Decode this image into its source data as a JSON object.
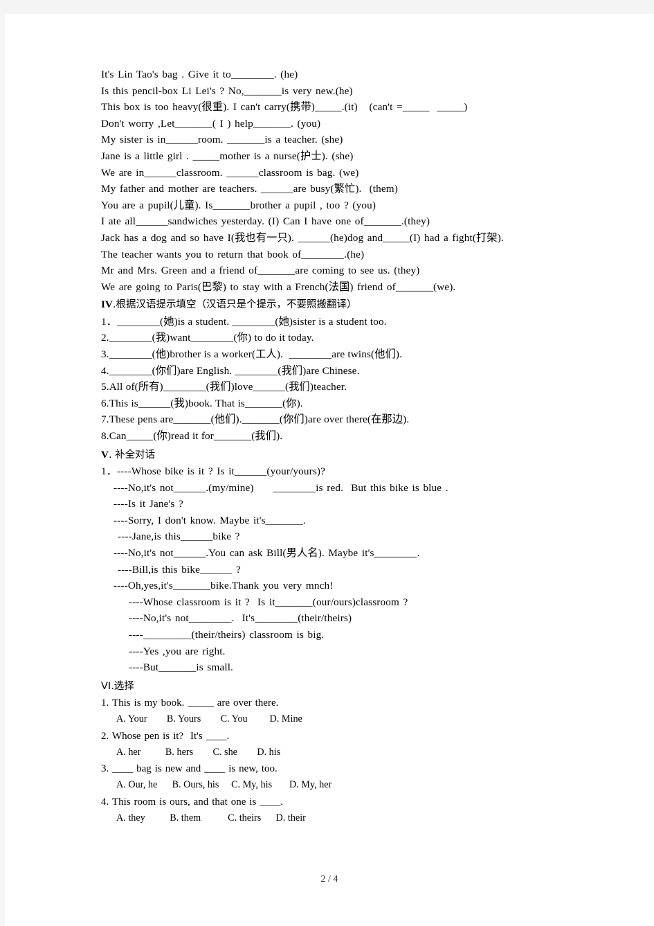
{
  "page": {
    "footer": "2 / 4"
  },
  "section_3_lines": [
    "It's Lin Tao's bag . Give it to________. (he)",
    "Is this pencil-box Li Lei's ? No,_______is very new.(he)",
    "This box is too heavy(很重). I can't carry(携带)_____.(it)   (can't =_____  _____)",
    "Don't worry ,Let_______( I ) help_______. (you)",
    "My sister is in______room. _______is a teacher. (she)",
    "Jane is a little girl . _____mother is a nurse(护士). (she)",
    "We are in______classroom. ______classroom is bag. (we)",
    "My father and mother are teachers. ______are busy(繁忙).  (them)",
    "You are a pupil(儿童). Is_______brother a pupil , too ? (you)",
    "I ate all______sandwiches yesterday. (I) Can I have one of_______.(they)",
    "Jack has a dog and so have I(我也有一只). ______(he)dog and_____(I) had a fight(打架).",
    "The teacher wants you to return that book of________.(he)",
    "Mr and Mrs. Green and a friend of_______are coming to see us. (they)",
    "We are going to Paris(巴黎) to stay with a French(法国) friend of_______(we)."
  ],
  "section_4": {
    "numeral": "IV",
    "heading": ".根据汉语提示填空（汉语只是个提示，不要照搬翻译）",
    "items": [
      "1．________(她)is a student. ________(她)sister is a student too.",
      "2.________(我)want________(你) to do it today.",
      "3.________(他)brother is a worker(工人).  ________are twins(他们).",
      "4.________(你们)are English. ________(我们)are Chinese.",
      "5.All of(所有)________(我们)love______(我们)teacher.",
      "6.This is______(我)book. That is_______(你).",
      "7.These pens are_______(他们)._______(你们)are over there(在那边).",
      "8.Can_____(你)read it for_______(我们)."
    ]
  },
  "section_5": {
    "numeral": "V",
    "heading": ". 补全对话",
    "lines": [
      {
        "text": "1．----Whose bike is it ? Is it______(your/yours)?",
        "indent": "a"
      },
      {
        "text": "----No,it's not______.(my/mine)     ________is red.  But this bike is blue .",
        "indent": "b"
      },
      {
        "text": "----Is it Jane's ?",
        "indent": "b"
      },
      {
        "text": "----Sorry, I don't know. Maybe it's_______.",
        "indent": "b"
      },
      {
        "text": "----Jane,is this______bike ?",
        "indent": "c"
      },
      {
        "text": "----No,it's not______.You can ask Bill(男人名). Maybe it's________.",
        "indent": "b"
      },
      {
        "text": "----Bill,is this bike______ ?",
        "indent": "c"
      },
      {
        "text": "----Oh,yes,it's_______bike.Thank you very mnch!",
        "indent": "b"
      },
      {
        "text": "----Whose classroom is it ?  Is it_______(our/ours)classroom ?",
        "indent": "e"
      },
      {
        "text": "----No,it's not________.  It's________(their/theirs)",
        "indent": "e"
      },
      {
        "text": "----_________(their/theirs) classroom is big.",
        "indent": "e"
      },
      {
        "text": "----Yes ,you are right.",
        "indent": "e"
      },
      {
        "text": "----But_______is small.",
        "indent": "e"
      }
    ]
  },
  "section_6": {
    "heading": "VI.选择",
    "questions": [
      {
        "stem": "1. This is my book. _____ are over there.",
        "options": "A. Your        B. Yours        C. You         D. Mine"
      },
      {
        "stem": "2. Whose pen is it?  It's ____.",
        "options": "A. her          B. hers        C. she        D. his"
      },
      {
        "stem": "3. ____ bag is new and ____ is new, too.",
        "options": "A. Our, he      B. Ours, his     C. My, his       D. My, her"
      },
      {
        "stem": "4. This room is ours, and that one is ____.",
        "options": "A. they          B. them           C. theirs      D. their"
      }
    ]
  }
}
